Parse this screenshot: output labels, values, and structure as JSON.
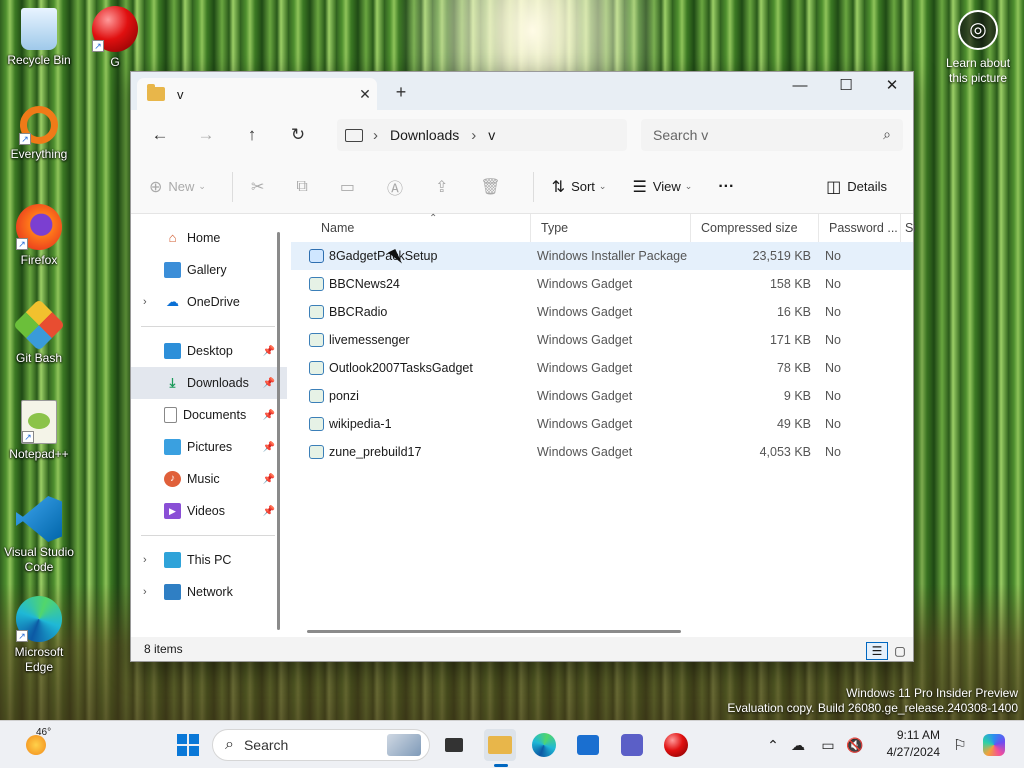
{
  "desktop": {
    "icons": [
      {
        "label": "Recycle Bin",
        "name": "recycle-bin-icon"
      },
      {
        "label": "G",
        "name": "red-ball-icon"
      },
      {
        "label": "Everything",
        "name": "everything-icon"
      },
      {
        "label": "Firefox",
        "name": "firefox-icon"
      },
      {
        "label": "Git Bash",
        "name": "git-bash-icon"
      },
      {
        "label": "Notepad++",
        "name": "notepadpp-icon"
      },
      {
        "label": "Visual Studio Code",
        "name": "vscode-icon"
      },
      {
        "label": "Microsoft Edge",
        "name": "edge-icon"
      }
    ],
    "learn_about": "Learn about this picture",
    "watermark_line1": "Windows 11 Pro Insider Preview",
    "watermark_line2": "Evaluation copy. Build 26080.ge_release.240308-1400"
  },
  "window": {
    "tab_title": "v",
    "breadcrumb": [
      "Downloads",
      "v"
    ],
    "search_placeholder": "Search v",
    "toolbar": {
      "new": "New",
      "sort": "Sort",
      "view": "View",
      "more": "···",
      "details": "Details"
    },
    "nav": {
      "home": "Home",
      "gallery": "Gallery",
      "onedrive": "OneDrive",
      "desktop": "Desktop",
      "downloads": "Downloads",
      "documents": "Documents",
      "pictures": "Pictures",
      "music": "Music",
      "videos": "Videos",
      "thispc": "This PC",
      "network": "Network"
    },
    "columns": {
      "name": "Name",
      "type": "Type",
      "size": "Compressed size",
      "password": "Password ...",
      "extra": "Si"
    },
    "files": [
      {
        "name": "8GadgetPackSetup",
        "type": "Windows Installer Package",
        "size": "23,519 KB",
        "password": "No"
      },
      {
        "name": "BBCNews24",
        "type": "Windows Gadget",
        "size": "158 KB",
        "password": "No"
      },
      {
        "name": "BBCRadio",
        "type": "Windows Gadget",
        "size": "16 KB",
        "password": "No"
      },
      {
        "name": "livemessenger",
        "type": "Windows Gadget",
        "size": "171 KB",
        "password": "No"
      },
      {
        "name": "Outlook2007TasksGadget",
        "type": "Windows Gadget",
        "size": "78 KB",
        "password": "No"
      },
      {
        "name": "ponzi",
        "type": "Windows Gadget",
        "size": "9 KB",
        "password": "No"
      },
      {
        "name": "wikipedia-1",
        "type": "Windows Gadget",
        "size": "49 KB",
        "password": "No"
      },
      {
        "name": "zune_prebuild17",
        "type": "Windows Gadget",
        "size": "4,053 KB",
        "password": "No"
      }
    ],
    "status": "8 items"
  },
  "taskbar": {
    "weather": "46°",
    "search": "Search",
    "time": "9:11 AM",
    "date": "4/27/2024"
  }
}
